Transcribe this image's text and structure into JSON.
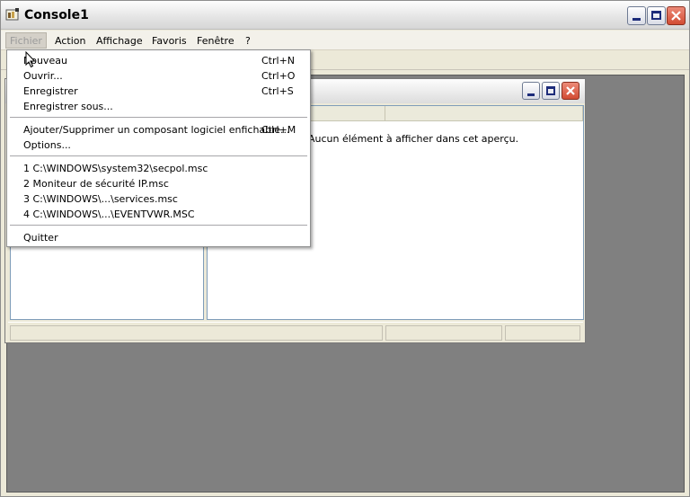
{
  "window": {
    "title": "Console1"
  },
  "menubar": {
    "items": [
      "Fichier",
      "Action",
      "Affichage",
      "Favoris",
      "Fenêtre",
      "?"
    ]
  },
  "file_menu": {
    "group1": [
      {
        "label": "Nouveau",
        "shortcut": "Ctrl+N"
      },
      {
        "label": "Ouvrir...",
        "shortcut": "Ctrl+O"
      },
      {
        "label": "Enregistrer",
        "shortcut": "Ctrl+S"
      },
      {
        "label": "Enregistrer sous...",
        "shortcut": ""
      }
    ],
    "group2": [
      {
        "label": "Ajouter/Supprimer un composant logiciel enfichable...",
        "shortcut": "Ctrl+M"
      },
      {
        "label": "Options...",
        "shortcut": ""
      }
    ],
    "recent": [
      {
        "label": "1 C:\\WINDOWS\\system32\\secpol.msc"
      },
      {
        "label": "2 Moniteur de sécurité IP.msc"
      },
      {
        "label": "3 C:\\WINDOWS\\...\\services.msc"
      },
      {
        "label": "4 C:\\WINDOWS\\...\\EVENTVWR.MSC"
      }
    ],
    "quit": "Quitter"
  },
  "child_window": {
    "empty_message": "Aucun élément à afficher dans cet aperçu."
  },
  "colors": {
    "mdi_background": "#808080",
    "menu_highlight_text": "#9a9a9a"
  },
  "icons": [
    "console-icon",
    "minimize-icon",
    "maximize-icon",
    "close-icon",
    "mouse-pointer-icon"
  ]
}
